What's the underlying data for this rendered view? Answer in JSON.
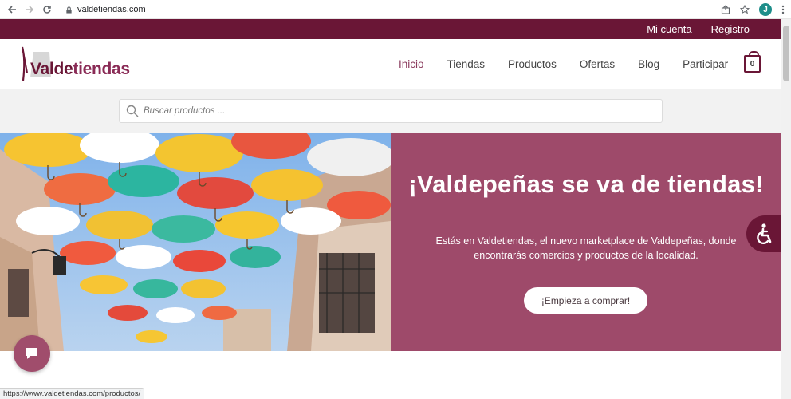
{
  "browser": {
    "url": "valdetiendas.com",
    "profile_initial": "J",
    "status_url": "https://www.valdetiendas.com/productos/"
  },
  "topbar": {
    "links": [
      "Mi cuenta",
      "Registro"
    ]
  },
  "header": {
    "logo_part1": "Valde",
    "logo_part2": "tiendas",
    "nav": [
      {
        "label": "Inicio",
        "active": true
      },
      {
        "label": "Tiendas"
      },
      {
        "label": "Productos"
      },
      {
        "label": "Ofertas"
      },
      {
        "label": "Blog"
      },
      {
        "label": "Participar"
      }
    ],
    "cart_count": "0"
  },
  "search": {
    "placeholder": "Buscar productos ..."
  },
  "hero": {
    "title": "¡Valdepeñas se va de tiendas!",
    "subtitle": "Estás en Valdetiendas, el nuevo marketplace de Valdepeñas, donde encontrarás comercios y productos de la localidad.",
    "cta": "¡Empieza a comprar!"
  },
  "colors": {
    "brand": "#6a1636",
    "hero_panel": "#9e4a6a",
    "search_band": "#f2f2f2"
  }
}
